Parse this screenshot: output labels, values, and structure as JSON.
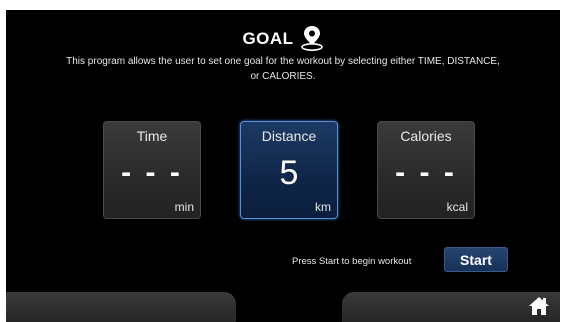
{
  "header": {
    "title": "GOAL",
    "icon": "location-pin-icon",
    "description": "This program allows the user to set one goal for the workout by selecting either TIME, DISTANCE, or CALORIES."
  },
  "goals": [
    {
      "label": "Time",
      "value": "- - -",
      "unit": "min",
      "selected": false
    },
    {
      "label": "Distance",
      "value": "5",
      "unit": "km",
      "selected": true
    },
    {
      "label": "Calories",
      "value": "- - -",
      "unit": "kcal",
      "selected": false
    }
  ],
  "footer": {
    "prompt": "Press Start to begin workout",
    "start_label": "Start",
    "home_icon": "home-icon"
  },
  "colors": {
    "background": "#000000",
    "selected_card": "#0f2648",
    "card": "#2a2a2a",
    "start_button": "#1f3b64"
  }
}
